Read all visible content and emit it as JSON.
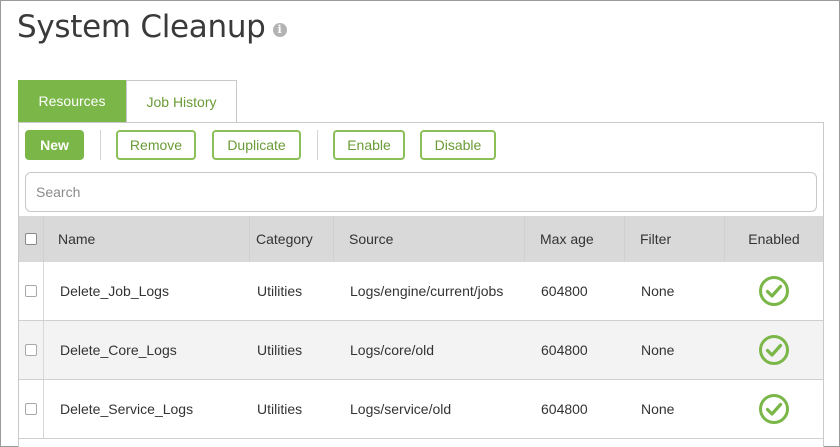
{
  "page": {
    "title": "System Cleanup"
  },
  "tabs": [
    {
      "label": "Resources",
      "active": true
    },
    {
      "label": "Job History",
      "active": false
    }
  ],
  "toolbar": {
    "new_label": "New",
    "remove_label": "Remove",
    "duplicate_label": "Duplicate",
    "enable_label": "Enable",
    "disable_label": "Disable"
  },
  "search": {
    "placeholder": "Search",
    "value": ""
  },
  "table": {
    "columns": {
      "name": "Name",
      "category": "Category",
      "source": "Source",
      "max_age": "Max age",
      "filter": "Filter",
      "enabled": "Enabled"
    },
    "rows": [
      {
        "name": "Delete_Job_Logs",
        "category": "Utilities",
        "source": "Logs/engine/current/jobs",
        "max_age": "604800",
        "filter": "None",
        "enabled": true
      },
      {
        "name": "Delete_Core_Logs",
        "category": "Utilities",
        "source": "Logs/core/old",
        "max_age": "604800",
        "filter": "None",
        "enabled": true
      },
      {
        "name": "Delete_Service_Logs",
        "category": "Utilities",
        "source": "Logs/service/old",
        "max_age": "604800",
        "filter": "None",
        "enabled": true
      }
    ]
  },
  "colors": {
    "accent": "#7ab648",
    "accent_text": "#6a9b37",
    "header_bg": "#d9d9d9",
    "alt_row_bg": "#f3f3f3"
  },
  "icons": {
    "info": "info-icon",
    "enabled": "check-circle-icon"
  }
}
